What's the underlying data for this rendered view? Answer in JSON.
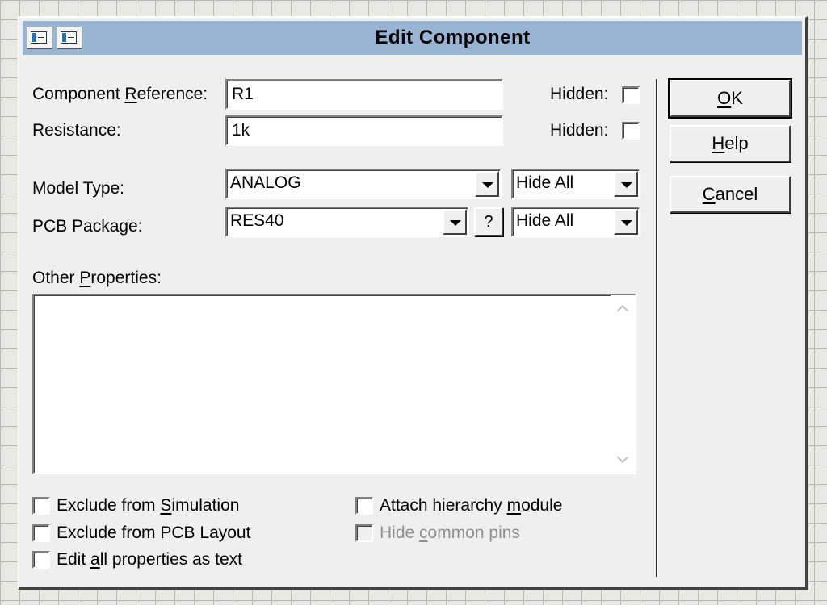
{
  "dialog": {
    "title": "Edit Component",
    "icons": [
      "properties-icon",
      "properties-icon-2"
    ]
  },
  "fields": {
    "reference_label_pre": "Component ",
    "reference_label_key": "R",
    "reference_label_post": "eference:",
    "reference_value": "R1",
    "resistance_label": "Resistance:",
    "resistance_value": "1k",
    "hidden_label": "Hidden:",
    "model_type_label": "Model Type:",
    "model_type_value": "ANALOG",
    "pcb_package_label": "PCB Package:",
    "pcb_package_value": "RES40",
    "pcb_help_label": "?",
    "hide_option_model": "Hide All",
    "hide_option_pcb": "Hide All"
  },
  "other_properties": {
    "label_pre": "Other ",
    "label_key": "P",
    "label_post": "roperties:",
    "text": ""
  },
  "buttons": {
    "ok_key": "O",
    "ok_rest": "K",
    "help_key": "H",
    "help_rest": "elp",
    "cancel_key": "C",
    "cancel_rest": "ancel"
  },
  "options": {
    "exclude_sim_pre": "Exclude from ",
    "exclude_sim_key": "S",
    "exclude_sim_post": "imulation",
    "exclude_pcb": "Exclude from PCB Layout",
    "edit_text_pre": "Edit ",
    "edit_text_key": "a",
    "edit_text_post": "ll properties as text",
    "attach_pre": "Attach hierarchy ",
    "attach_key": "m",
    "attach_post": "odule",
    "hide_pins_pre": "Hide ",
    "hide_pins_key": "c",
    "hide_pins_post": "ommon pins"
  }
}
